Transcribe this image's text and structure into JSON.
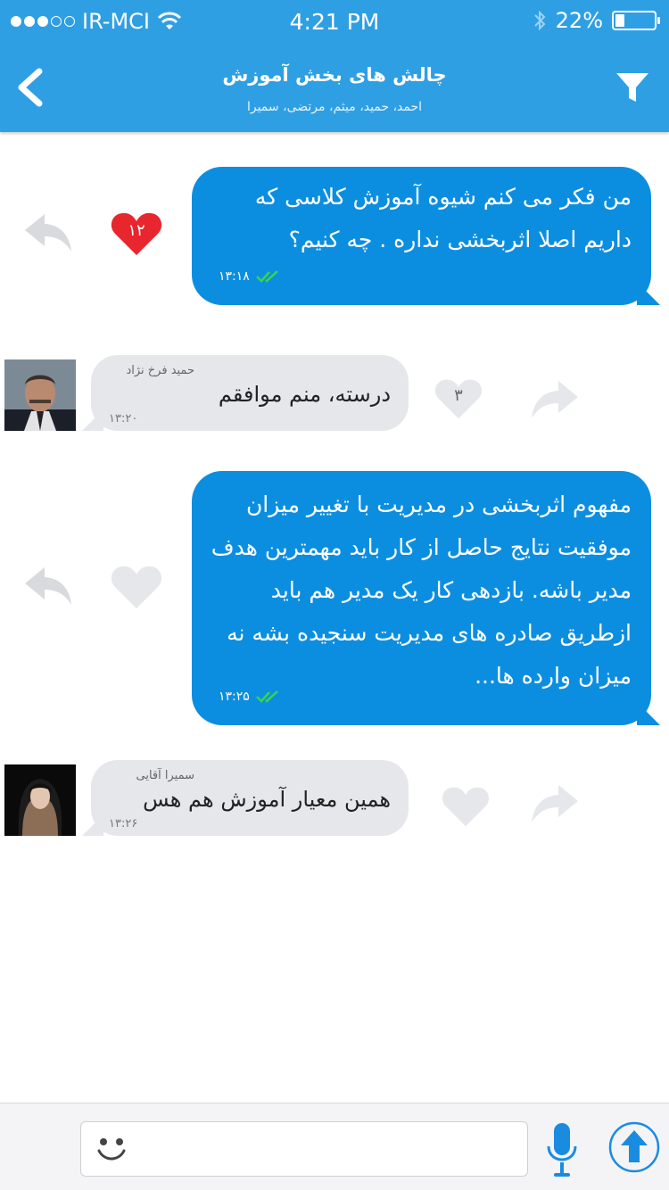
{
  "status_bar": {
    "carrier": "IR-MCI",
    "time": "4:21 PM",
    "battery": "22%",
    "battery_level": 0.22
  },
  "header": {
    "title": "چالش های بخش آموزش",
    "subtitle": "احمد، حمید، میثم، مرتضی، سمیرا"
  },
  "messages": [
    {
      "direction": "outgoing",
      "text": "من فکر می کنم شیوه آموزش کلاسی که داریم اصلا اثربخشی نداره . چه کنیم؟",
      "time": "۱۳:۱۸",
      "likes": "۱۲",
      "liked": true
    },
    {
      "direction": "incoming",
      "sender": "حمید فرخ نژاد",
      "text": "درسته، منم موافقم",
      "time": "۱۳:۲۰",
      "likes": "۳"
    },
    {
      "direction": "outgoing",
      "text": "مفهوم اثربخشی در مدیریت با تغییر میزان موفقیت نتایج حاصل از کار باید مهمترین هدف مدیر باشه. بازدهی کار یک مدیر هم باید ازطریق صادره های مدیریت سنجیده بشه نه میزان وارده ها...",
      "time": "۱۳:۲۵"
    },
    {
      "direction": "incoming",
      "sender": "سمیرا آقایی",
      "text": "همین معیار آموزش هم هس",
      "time": "۱۳:۲۶"
    }
  ],
  "composer": {
    "placeholder": ""
  },
  "colors": {
    "primary": "#2f9fe4",
    "bubble_out": "#0c8ee0",
    "bubble_in": "#e6e7eb",
    "liked_heart": "#e8262e",
    "read_check": "#39d353"
  }
}
